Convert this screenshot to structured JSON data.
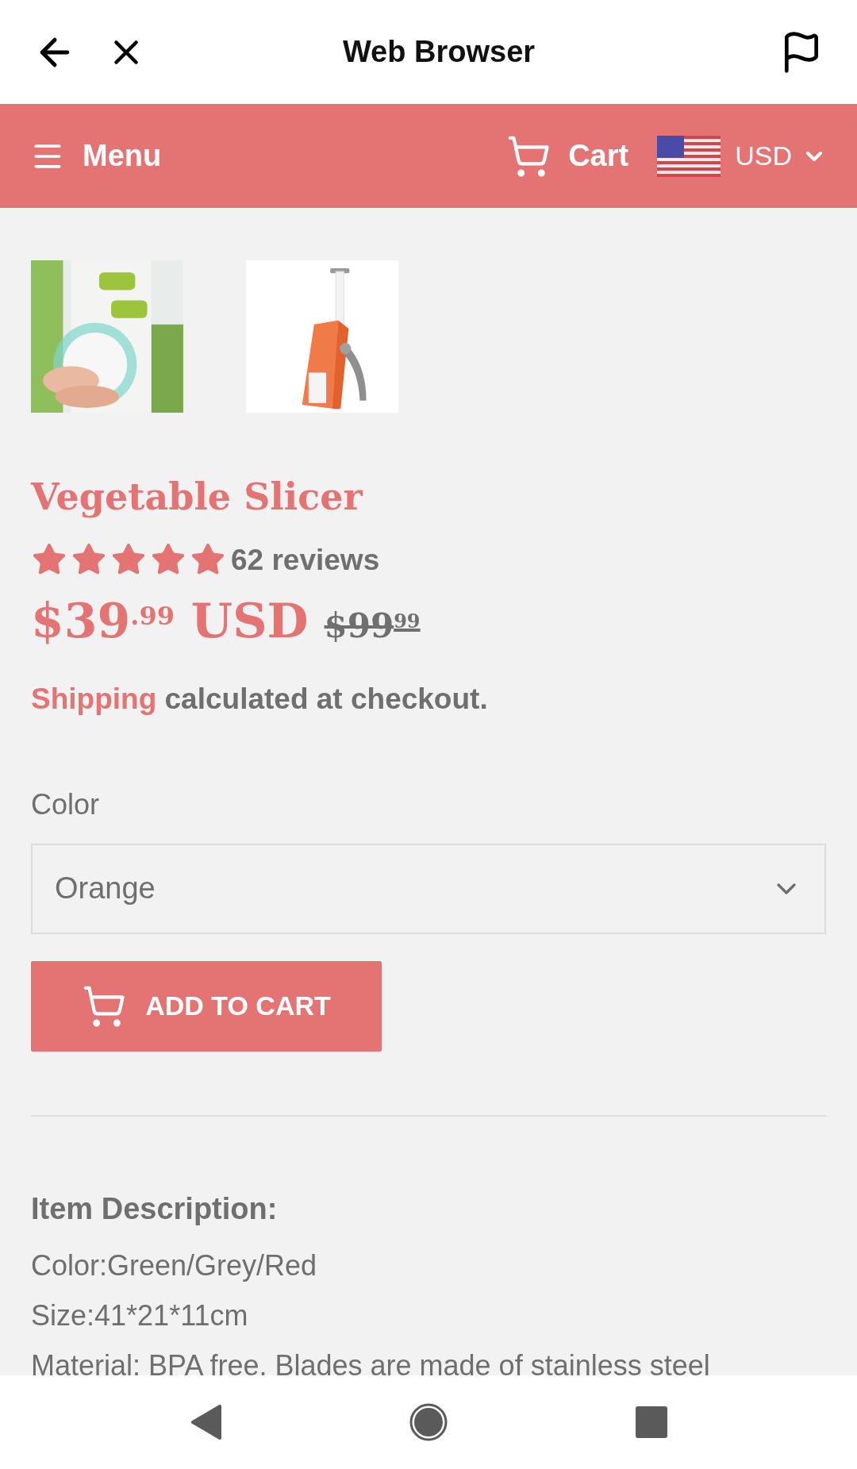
{
  "top_bar": {
    "title": "Web Browser"
  },
  "store_header": {
    "menu": "Menu",
    "cart": "Cart",
    "currency": "USD"
  },
  "product": {
    "title": "Vegetable Slicer",
    "stars": 5,
    "reviews": "62 reviews",
    "price": "$39$^{.99}$ USD",
    "compare_price": "$99$^{99}$",
    "shipping_link": "Shipping",
    "shipping_text": "calculated at checkout."
  },
  "option": {
    "label": "Color",
    "value": "Orange"
  },
  "add_to_cart": "ADD TO CART",
  "description": {
    "heading": "Item Description:",
    "lines": [
      "Color:Green/Grey/Red",
      "Size:41*21*11cm",
      "Material: BPA free. Blades are made of stainless steel"
    ]
  }
}
